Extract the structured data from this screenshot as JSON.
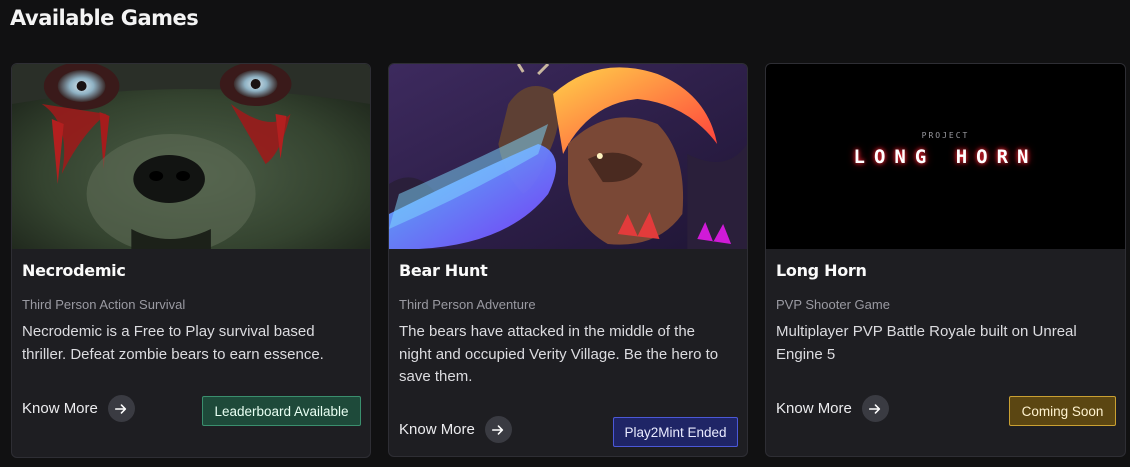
{
  "section": {
    "title": "Available Games"
  },
  "games": [
    {
      "title": "Necrodemic",
      "genre": "Third Person Action Survival",
      "description": "Necrodemic is a Free to Play survival based thriller. Defeat zombie bears to earn essence.",
      "know_more_label": "Know More",
      "badge_label": "Leaderboard Available",
      "badge_color": "#1e4a3a"
    },
    {
      "title": "Bear Hunt",
      "genre": "Third Person Adventure",
      "description": "The bears have attacked in the middle of the night and occupied Verity Village. Be the hero to save them.",
      "know_more_label": "Know More",
      "badge_label": "Play2Mint Ended",
      "badge_color": "#1f2566"
    },
    {
      "title": "Long Horn",
      "genre": "PVP Shooter Game",
      "description": "Multiplayer PVP Battle Royale built on Unreal Engine 5",
      "know_more_label": "Know More",
      "badge_label": "Coming Soon",
      "badge_color": "#5b4612",
      "art_logo_small": "PROJECT",
      "art_logo_big": "LONG HORN"
    }
  ],
  "icons": {
    "know_more": "arrow-right-icon"
  }
}
